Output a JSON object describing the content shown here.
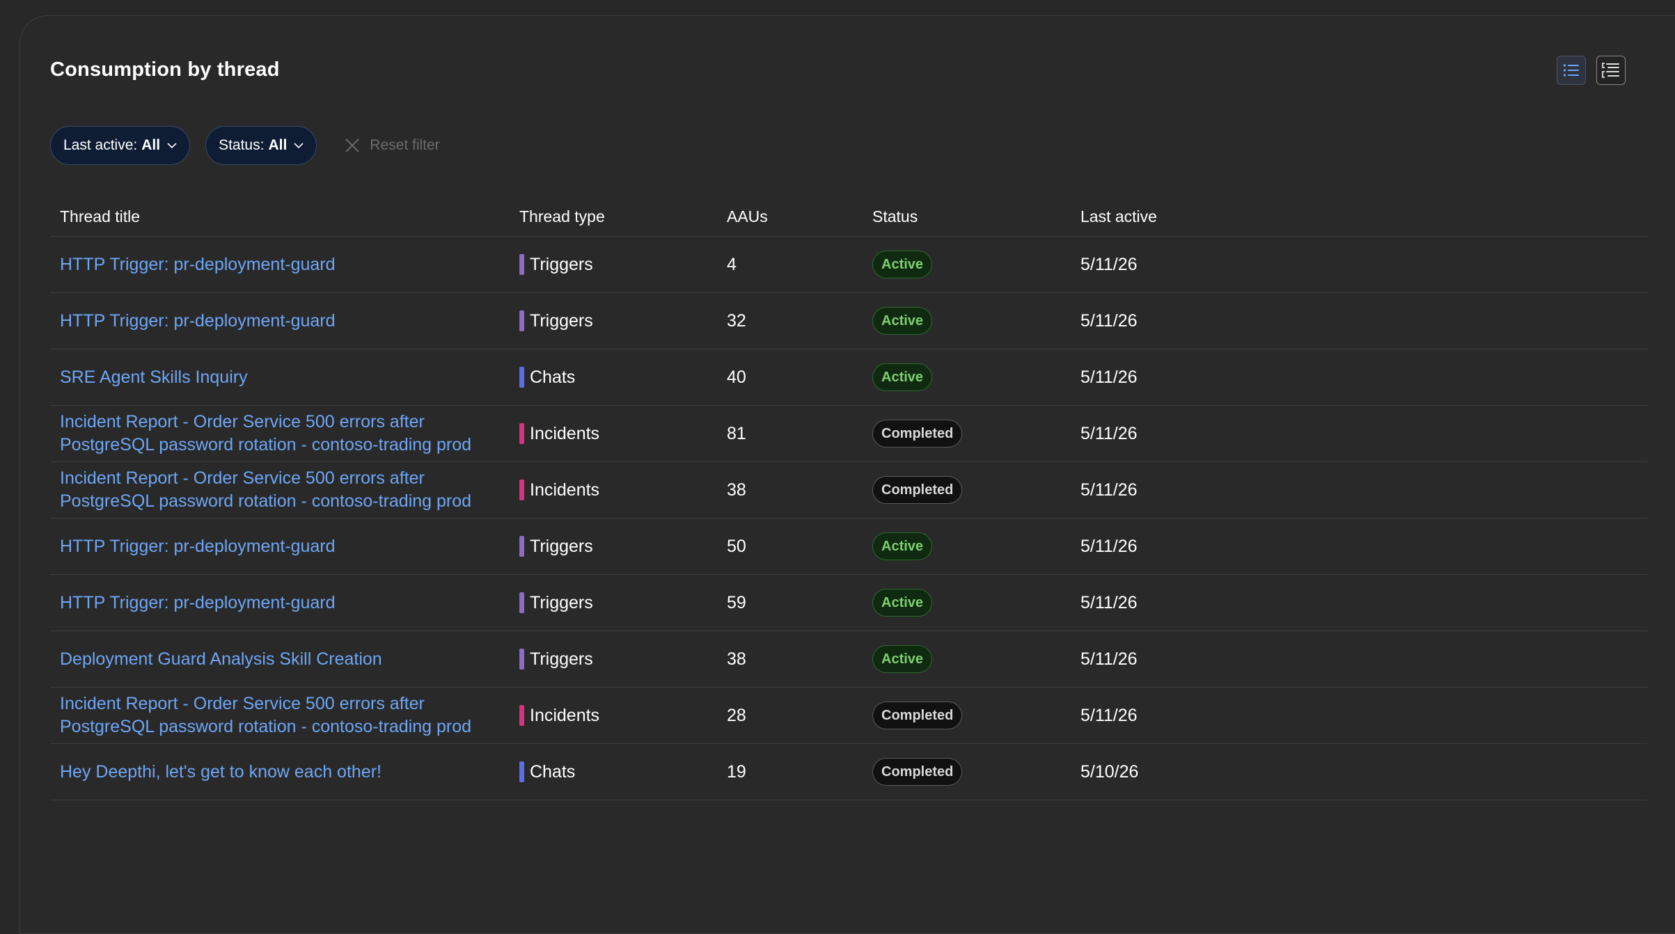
{
  "header": {
    "title": "Consumption by thread",
    "list_view_icon": "list-icon",
    "detail_view_icon": "detail-list-icon"
  },
  "filters": {
    "last_active_label": "Last active:",
    "last_active_value": "All",
    "status_label": "Status:",
    "status_value": "All",
    "reset_label": "Reset filter"
  },
  "colors": {
    "triggers": "#8b6bc4",
    "chats": "#5b6ee6",
    "incidents": "#d6337e",
    "link": "#6ea6f5",
    "active_badge": "#7fcf6f"
  },
  "table": {
    "columns": [
      "Thread title",
      "Thread type",
      "AAUs",
      "Status",
      "Last active"
    ],
    "rows": [
      {
        "title": "HTTP Trigger: pr-deployment-guard",
        "type": "Triggers",
        "aaus": "4",
        "status": "Active",
        "last_active": "5/11/26"
      },
      {
        "title": "HTTP Trigger: pr-deployment-guard",
        "type": "Triggers",
        "aaus": "32",
        "status": "Active",
        "last_active": "5/11/26"
      },
      {
        "title": "SRE Agent Skills Inquiry",
        "type": "Chats",
        "aaus": "40",
        "status": "Active",
        "last_active": "5/11/26"
      },
      {
        "title": "Incident Report - Order Service 500 errors after PostgreSQL password rotation - contoso-trading prod",
        "type": "Incidents",
        "aaus": "81",
        "status": "Completed",
        "last_active": "5/11/26"
      },
      {
        "title": "Incident Report - Order Service 500 errors after PostgreSQL password rotation - contoso-trading prod",
        "type": "Incidents",
        "aaus": "38",
        "status": "Completed",
        "last_active": "5/11/26"
      },
      {
        "title": "HTTP Trigger: pr-deployment-guard",
        "type": "Triggers",
        "aaus": "50",
        "status": "Active",
        "last_active": "5/11/26"
      },
      {
        "title": "HTTP Trigger: pr-deployment-guard",
        "type": "Triggers",
        "aaus": "59",
        "status": "Active",
        "last_active": "5/11/26"
      },
      {
        "title": "Deployment Guard Analysis Skill Creation",
        "type": "Triggers",
        "aaus": "38",
        "status": "Active",
        "last_active": "5/11/26"
      },
      {
        "title": "Incident Report - Order Service 500 errors after PostgreSQL password rotation - contoso-trading prod",
        "type": "Incidents",
        "aaus": "28",
        "status": "Completed",
        "last_active": "5/11/26"
      },
      {
        "title": "Hey Deepthi, let's get to know each other!",
        "type": "Chats",
        "aaus": "19",
        "status": "Completed",
        "last_active": "5/10/26"
      }
    ]
  }
}
